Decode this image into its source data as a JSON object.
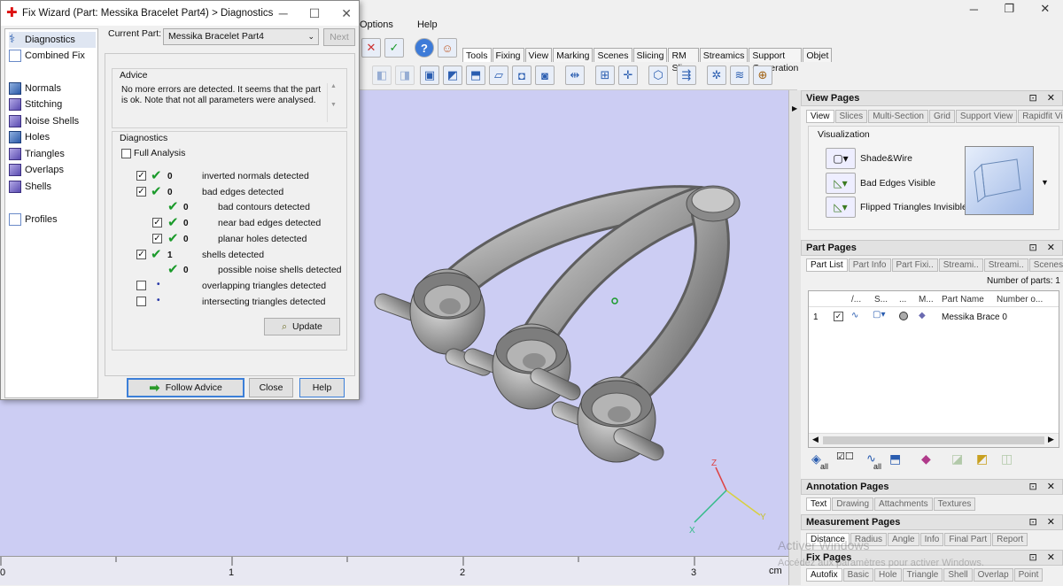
{
  "app": {
    "menu": [
      "Options",
      "Help"
    ],
    "window_controls": [
      "─",
      "❐",
      "✕"
    ],
    "toolbar_tabs": [
      "Tools",
      "Fixing",
      "View",
      "Marking",
      "Scenes",
      "Slicing",
      "RM Slicer",
      "Streamics",
      "Support Generation",
      "Objet"
    ],
    "active_tab": "Tools"
  },
  "ruler": {
    "ticks": [
      "0",
      "1",
      "2",
      "3"
    ],
    "unit": "cm"
  },
  "axis_labels": {
    "z": "Z",
    "y": "Y",
    "x": "X"
  },
  "watermark": {
    "line1": "Activer Windows",
    "line2": "Accédez aux paramètres pour activer Windows."
  },
  "right_panel": {
    "view_pages": {
      "title": "View Pages",
      "tabs": [
        "View",
        "Slices",
        "Multi-Section",
        "Grid",
        "Support View",
        "Rapidfit View"
      ],
      "visualization_label": "Visualization",
      "items": [
        "Shade&Wire",
        "Bad Edges Visible",
        "Flipped Triangles Invisible"
      ]
    },
    "part_pages": {
      "title": "Part Pages",
      "tabs": [
        "Part List",
        "Part Info",
        "Part Fixi..",
        "Streami..",
        "Streami..",
        "Scenes"
      ],
      "parts_count": "Number of parts: 1",
      "columns": [
        "/...",
        "S...",
        "...",
        "M...",
        "Part Name",
        "Number o..."
      ],
      "rows": [
        {
          "index": "1",
          "name": "Messika Brace 0"
        }
      ],
      "bottom_label_all": "all"
    },
    "annotation_pages": {
      "title": "Annotation Pages",
      "tabs": [
        "Text",
        "Drawing",
        "Attachments",
        "Textures"
      ]
    },
    "measurement_pages": {
      "title": "Measurement Pages",
      "tabs": [
        "Distance",
        "Radius",
        "Angle",
        "Info",
        "Final Part",
        "Report"
      ]
    },
    "fix_pages": {
      "title": "Fix Pages",
      "tabs": [
        "Autofix",
        "Basic",
        "Hole",
        "Triangle",
        "Shell",
        "Overlap",
        "Point"
      ]
    },
    "panel_controls": "⊡ ✕"
  },
  "fix_wizard": {
    "title": "Fix Wizard (Part: Messika Bracelet Part4) > Diagnostics",
    "controls": [
      "─",
      "☐",
      "✕"
    ],
    "nav": [
      {
        "label": "Diagnostics",
        "icon": "stethoscope-icon",
        "selected": true
      },
      {
        "label": "Combined Fix",
        "icon": "combined-fix-icon"
      },
      {
        "label": "Normals",
        "icon": "normals-icon"
      },
      {
        "label": "Stitching",
        "icon": "stitching-icon"
      },
      {
        "label": "Noise Shells",
        "icon": "noise-shells-icon"
      },
      {
        "label": "Holes",
        "icon": "holes-icon"
      },
      {
        "label": "Triangles",
        "icon": "triangles-icon"
      },
      {
        "label": "Overlaps",
        "icon": "overlaps-icon"
      },
      {
        "label": "Shells",
        "icon": "shells-icon"
      },
      {
        "label": "Profiles",
        "icon": "profiles-icon"
      }
    ],
    "current_part_label": "Current Part:",
    "current_part_value": "Messika Bracelet Part4",
    "next_button": "Next",
    "advice_title": "Advice",
    "advice_text": "No more errors are detected. It seems that the part is ok. Note that not all parameters were analysed.",
    "diagnostics_title": "Diagnostics",
    "full_analysis": "Full Analysis",
    "diagnostics": [
      {
        "count": "0",
        "label": "inverted normals detected"
      },
      {
        "count": "0",
        "label": "bad edges detected"
      },
      {
        "count": "0",
        "label": "bad contours detected"
      },
      {
        "count": "0",
        "label": "near bad edges detected"
      },
      {
        "count": "0",
        "label": "planar holes detected"
      },
      {
        "count": "1",
        "label": "shells detected"
      },
      {
        "count": "0",
        "label": "possible noise shells detected"
      },
      {
        "count": "•",
        "label": "overlapping triangles detected"
      },
      {
        "count": "•",
        "label": "intersecting triangles detected"
      }
    ],
    "update_button": "Update",
    "follow_advice_button": "Follow Advice",
    "close_button": "Close",
    "help_button": "Help"
  }
}
